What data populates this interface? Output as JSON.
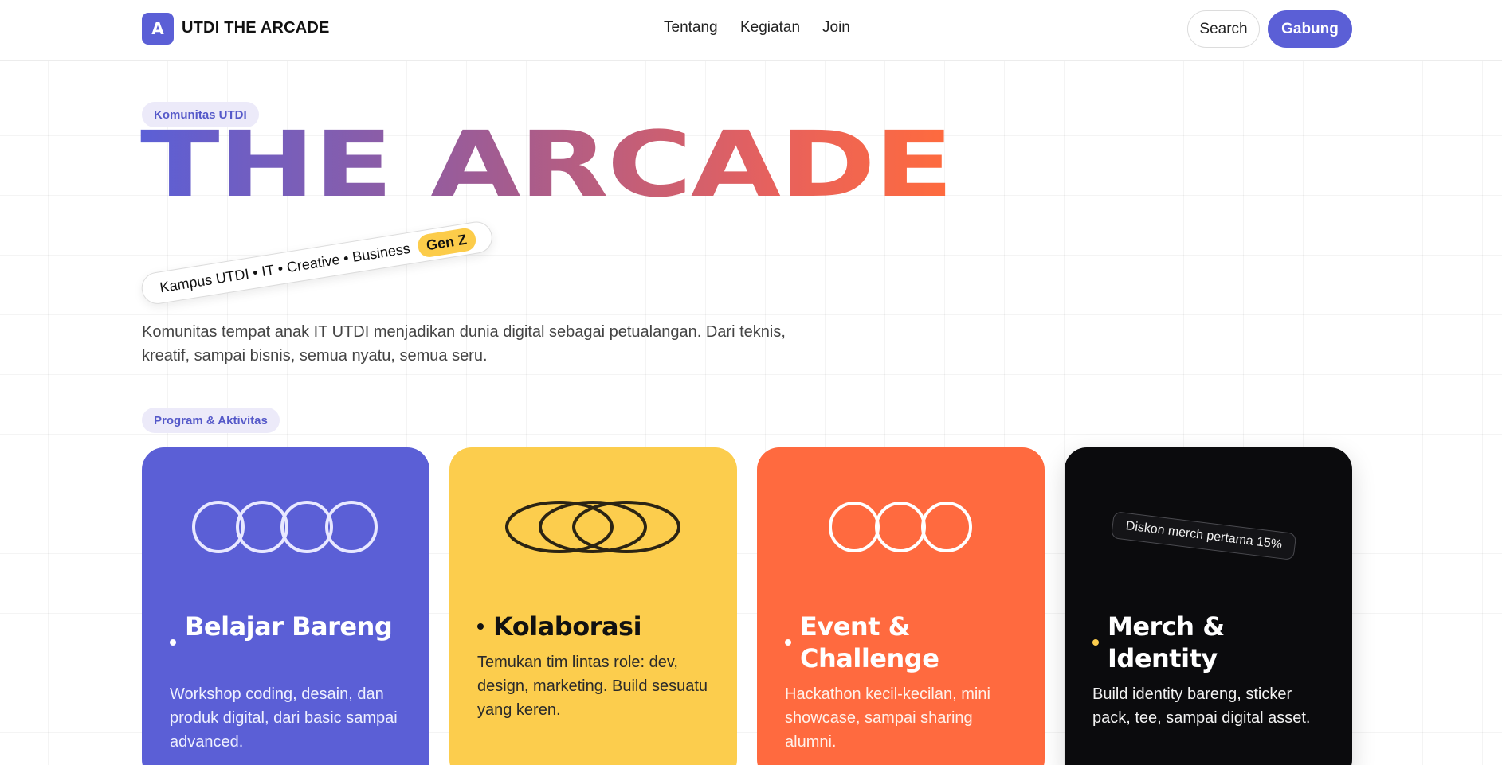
{
  "header": {
    "logo_letter": "A",
    "brand": "UTDI THE ARCADE",
    "nav": [
      "Tentang",
      "Kegiatan",
      "Join"
    ],
    "search_label": "Search",
    "join_label": "Gabung"
  },
  "hero": {
    "eyebrow": "Komunitas UTDI",
    "title": "THE ARCADE",
    "tagline": "Kampus UTDI • IT • Creative • Business",
    "badge": "Gen Z",
    "description": "Komunitas tempat anak IT UTDI menjadikan dunia digital sebagai petualangan. Dari teknis, kreatif, sampai bisnis, semua nyatu, semua seru."
  },
  "programs": {
    "eyebrow": "Program & Aktivitas",
    "cards": [
      {
        "title": "Belajar Bareng",
        "description": "Workshop coding, desain, dan produk digital, dari basic sampai advanced.",
        "color": "#5b5fd6"
      },
      {
        "title": "Kolaborasi",
        "description": "Temukan tim lintas role: dev, design, marketing. Build sesuatu yang keren.",
        "color": "#fccd4d"
      },
      {
        "title": "Event & Challenge",
        "description": "Hackathon kecil-kecilan, mini showcase, sampai sharing alumni.",
        "color": "#ff6a3f"
      },
      {
        "title": "Merch & Identity",
        "description": "Build identity bareng, sticker pack, tee, sampai digital asset.",
        "tag": "Diskon merch pertama 15%",
        "color": "#0b0b0d"
      }
    ]
  },
  "colors": {
    "primary": "#5b5fd6",
    "yellow": "#fccd4d",
    "orange": "#ff6a3f",
    "dark": "#0b0b0d"
  }
}
